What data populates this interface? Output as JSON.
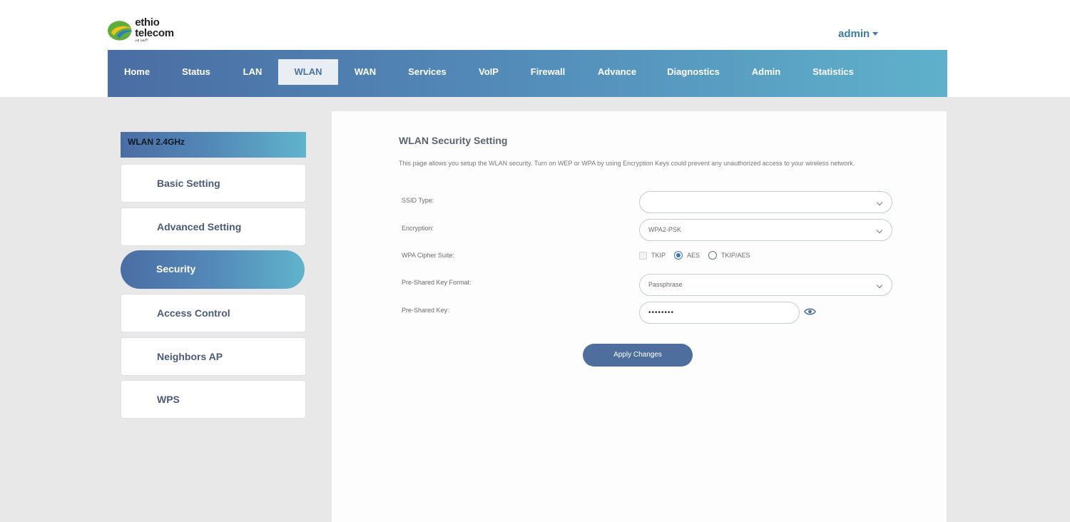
{
  "brand": {
    "name": "ethio telecom",
    "tagline": "ዐቲ ህልም"
  },
  "user": {
    "name": "admin"
  },
  "nav": {
    "items": [
      "Home",
      "Status",
      "LAN",
      "WLAN",
      "WAN",
      "Services",
      "VoIP",
      "Firewall",
      "Advance",
      "Diagnostics",
      "Admin",
      "Statistics"
    ],
    "active": "WLAN"
  },
  "sidebar": {
    "header": "WLAN 2.4GHz",
    "items": [
      "Basic Setting",
      "Advanced Setting",
      "Security",
      "Access Control",
      "Neighbors AP",
      "WPS"
    ],
    "active": "Security"
  },
  "page": {
    "title": "WLAN Security Setting",
    "description": "This page allows you setup the WLAN security. Turn on WEP or WPA by using Encryption Keys could prevent any unauthorized access to your wireless network."
  },
  "form": {
    "ssid_type": {
      "label": "SSID Type:",
      "value": ""
    },
    "encryption": {
      "label": "Encryption:",
      "value": "WPA2-PSK"
    },
    "cipher": {
      "label": "WPA Cipher Suite:",
      "options": [
        {
          "label": "TKIP",
          "kind": "checkbox",
          "checked": false
        },
        {
          "label": "AES",
          "kind": "radio",
          "checked": true
        },
        {
          "label": "TKIP/AES",
          "kind": "radio",
          "checked": false
        }
      ]
    },
    "psk_format": {
      "label": "Pre-Shared Key Format:",
      "value": "Passphrase"
    },
    "psk": {
      "label": "Pre-Shared Key:",
      "value": "••••••••"
    },
    "apply_label": "Apply Changes"
  },
  "colors": {
    "nav_start": "#4a6da4",
    "nav_end": "#5fb1cb",
    "accent": "#3c7bb0",
    "button": "#4e6f9d",
    "radio_on": "#3c74c7"
  }
}
